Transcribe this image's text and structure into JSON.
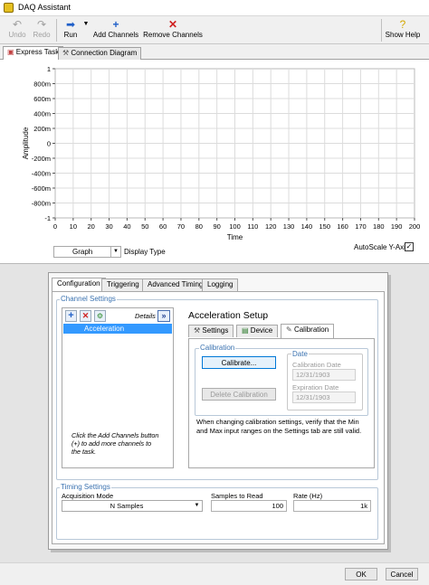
{
  "window": {
    "title": "DAQ Assistant"
  },
  "toolbar": {
    "undo": "Undo",
    "redo": "Redo",
    "run": "Run",
    "add_channels": "Add Channels",
    "remove_channels": "Remove Channels",
    "show_help": "Show Help"
  },
  "main_tabs": [
    "Express Task",
    "Connection Diagram"
  ],
  "graph": {
    "y_label": "Amplitude",
    "x_label": "Time",
    "y_ticks": [
      "1",
      "800m",
      "600m",
      "400m",
      "200m",
      "0",
      "-200m",
      "-400m",
      "-600m",
      "-800m",
      "-1"
    ],
    "x_ticks": [
      "0",
      "10",
      "20",
      "30",
      "40",
      "50",
      "60",
      "70",
      "80",
      "90",
      "100",
      "110",
      "120",
      "130",
      "140",
      "150",
      "160",
      "170",
      "180",
      "190",
      "200"
    ],
    "display_type_value": "Graph",
    "display_type_label": "Display Type",
    "autoscale_label": "AutoScale Y-Axis",
    "autoscale_checked": true
  },
  "config_tabs": [
    "Configuration",
    "Triggering",
    "Advanced Timing",
    "Logging"
  ],
  "channel_settings": {
    "group_label": "Channel Settings",
    "details_label": "Details",
    "channels": [
      "Acceleration"
    ],
    "hint": "Click the Add Channels button (+) to add more channels to the task."
  },
  "setup": {
    "title": "Acceleration Setup",
    "tabs": [
      "Settings",
      "Device",
      "Calibration"
    ],
    "calibration": {
      "group_label": "Calibration",
      "calibrate_button": "Calibrate...",
      "delete_button": "Delete Calibration",
      "date_group_label": "Date",
      "calibration_date_label": "Calibration Date",
      "calibration_date": "12/31/1903",
      "expiration_date_label": "Expiration Date",
      "expiration_date": "12/31/1903",
      "note": "When changing calibration settings, verify that the Min and Max input ranges on the Settings tab are still valid."
    }
  },
  "timing": {
    "group_label": "Timing Settings",
    "acq_mode_label": "Acquisition Mode",
    "acq_mode_value": "N Samples",
    "samples_label": "Samples to Read",
    "samples_value": "100",
    "rate_label": "Rate (Hz)",
    "rate_value": "1k"
  },
  "footer": {
    "ok": "OK",
    "cancel": "Cancel"
  },
  "colors": {
    "selection": "#3399ff",
    "accent": "#3a72b0"
  }
}
